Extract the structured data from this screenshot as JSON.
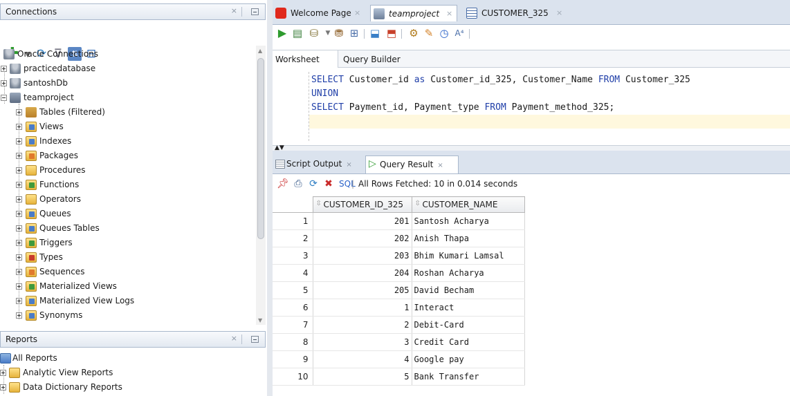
{
  "connections_panel": {
    "title": "Connections",
    "close_glyph": "×",
    "scroll_up_glyph": "▲",
    "scroll_down_glyph": "▼",
    "toolbar_icons": [
      "add-connection-icon",
      "dropdown-arrow-icon",
      "refresh-icon",
      "filter-icon",
      "schema-browser-icon",
      "collapse-icon"
    ],
    "tree": [
      {
        "label": "Oracle Connections",
        "icon": "database-icon"
      },
      {
        "label": "practicedatabase",
        "icon": "database-icon"
      },
      {
        "label": "santoshDb",
        "icon": "database-icon"
      },
      {
        "label": "teamproject",
        "icon": "connection-icon"
      },
      {
        "label": "Tables (Filtered)",
        "icon": "tables-icon"
      },
      {
        "label": "Views",
        "icon": "views-icon"
      },
      {
        "label": "Indexes",
        "icon": "indexes-icon"
      },
      {
        "label": "Packages",
        "icon": "packages-icon"
      },
      {
        "label": "Procedures",
        "icon": "procedures-icon"
      },
      {
        "label": "Functions",
        "icon": "functions-icon"
      },
      {
        "label": "Operators",
        "icon": "operators-icon"
      },
      {
        "label": "Queues",
        "icon": "queues-icon"
      },
      {
        "label": "Queues Tables",
        "icon": "queues-tables-icon"
      },
      {
        "label": "Triggers",
        "icon": "triggers-icon"
      },
      {
        "label": "Types",
        "icon": "types-icon"
      },
      {
        "label": "Sequences",
        "icon": "sequences-icon"
      },
      {
        "label": "Materialized Views",
        "icon": "materialized-views-icon"
      },
      {
        "label": "Materialized View Logs",
        "icon": "materialized-view-logs-icon"
      },
      {
        "label": "Synonyms",
        "icon": "synonyms-icon"
      }
    ]
  },
  "reports_panel": {
    "title": "Reports",
    "close_glyph": "×",
    "items": [
      {
        "label": "All Reports",
        "icon": "reports-icon"
      },
      {
        "label": "Analytic View Reports",
        "icon": "folder-icon"
      },
      {
        "label": "Data Dictionary Reports",
        "icon": "folder-icon"
      }
    ]
  },
  "document_tabs": [
    {
      "label": "Welcome Page",
      "icon": "oracle-icon",
      "close": "×"
    },
    {
      "label": "teamproject",
      "icon": "sql-worksheet-icon",
      "close": "×"
    },
    {
      "label": "CUSTOMER_325",
      "icon": "table-icon",
      "close": "×"
    }
  ],
  "editor_toolbar_icons": [
    "run-statement-icon",
    "run-script-icon",
    "commit-icon",
    "rollback-icon",
    "explain-plan-icon",
    "autotrace-icon",
    "tuning-icon",
    "unshared-sql-icon",
    "clear-icon",
    "history-icon",
    "format-icon"
  ],
  "worksheet_tabs": [
    "Worksheet",
    "Query Builder"
  ],
  "sql_lines": [
    [
      {
        "t": "SELECT",
        "k": true
      },
      {
        "t": " Customer_id ",
        "k": false
      },
      {
        "t": "as",
        "k": true
      },
      {
        "t": " Customer_id_325, Customer_Name ",
        "k": false
      },
      {
        "t": "FROM",
        "k": true
      },
      {
        "t": " Customer_325",
        "k": false
      }
    ],
    [
      {
        "t": "UNION",
        "k": true
      }
    ],
    [
      {
        "t": "SELECT",
        "k": true
      },
      {
        "t": " Payment_id, Payment_type ",
        "k": false
      },
      {
        "t": "FROM",
        "k": true
      },
      {
        "t": " Payment_method_325;",
        "k": false
      }
    ]
  ],
  "splitter_glyph": "▲▼",
  "output_tabs": [
    {
      "label": "Script Output",
      "close": "×"
    },
    {
      "label": "Query Result",
      "close": "×"
    }
  ],
  "results": {
    "sql_label": "SQL",
    "separator": "|",
    "status": "All Rows Fetched: 10 in 0.014 seconds",
    "columns": [
      "CUSTOMER_ID_325",
      "CUSTOMER_NAME"
    ],
    "rows": [
      {
        "n": "1",
        "id": "201",
        "name": "Santosh Acharya"
      },
      {
        "n": "2",
        "id": "202",
        "name": "Anish Thapa"
      },
      {
        "n": "3",
        "id": "203",
        "name": "Bhim Kumari Lamsal"
      },
      {
        "n": "4",
        "id": "204",
        "name": "Roshan Acharya"
      },
      {
        "n": "5",
        "id": "205",
        "name": "David Becham"
      },
      {
        "n": "6",
        "id": "1",
        "name": "Interact"
      },
      {
        "n": "7",
        "id": "2",
        "name": "Debit-Card"
      },
      {
        "n": "8",
        "id": "3",
        "name": "Credit Card"
      },
      {
        "n": "9",
        "id": "4",
        "name": "Google pay"
      },
      {
        "n": "10",
        "id": "5",
        "name": "Bank Transfer"
      }
    ]
  },
  "colors": {
    "keyword": "#1f3ea8",
    "panel_header": "#dbe3ee",
    "current_line": "#fff8de",
    "sql_link": "#2a62c9"
  }
}
